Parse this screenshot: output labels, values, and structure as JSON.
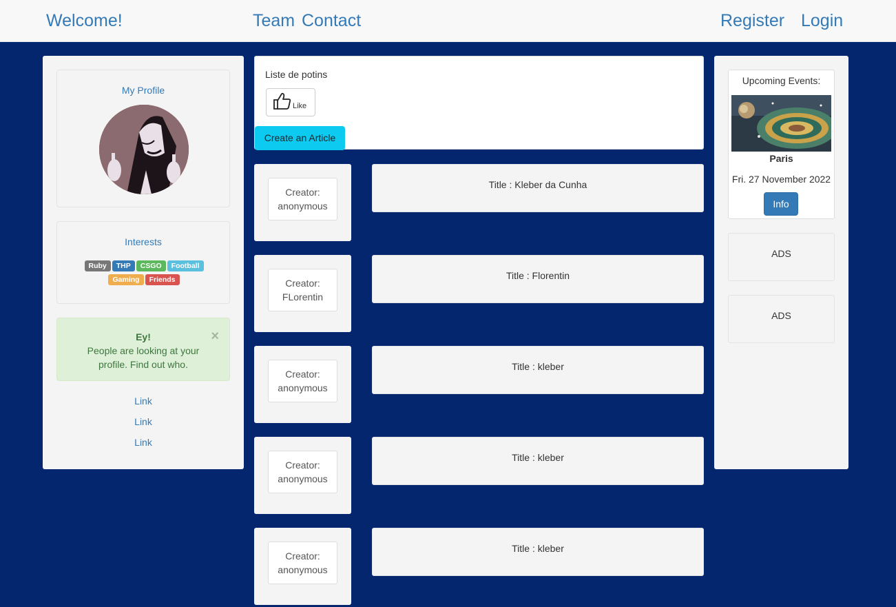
{
  "navbar": {
    "brand": "Welcome!",
    "team": "Team",
    "contact": "Contact",
    "register": "Register",
    "login": "Login"
  },
  "profile": {
    "title": "My Profile"
  },
  "interests": {
    "title": "Interests",
    "badges": [
      {
        "label": "Ruby",
        "color": "#777777"
      },
      {
        "label": "THP",
        "color": "#337ab7"
      },
      {
        "label": "CSGO",
        "color": "#5cb85c"
      },
      {
        "label": "Football",
        "color": "#5bc0de"
      },
      {
        "label": "Gaming",
        "color": "#f0ad4e"
      },
      {
        "label": "Friends",
        "color": "#d9534f"
      }
    ]
  },
  "alert": {
    "title": "Ey!",
    "line1": "People are looking at your",
    "line2": "profile. Find out who.",
    "close": "×"
  },
  "left_links": [
    "Link",
    "Link",
    "Link"
  ],
  "potins": {
    "title": "Liste de potins",
    "like_label": "Like",
    "create_label": "Create an Article"
  },
  "articles": [
    {
      "creator_label": "Creator:",
      "creator": "anonymous",
      "title": "Title : Kleber da Cunha"
    },
    {
      "creator_label": "Creator:",
      "creator": "FLorentin",
      "title": "Title : Florentin"
    },
    {
      "creator_label": "Creator:",
      "creator": "anonymous",
      "title": "Title : kleber"
    },
    {
      "creator_label": "Creator:",
      "creator": "anonymous",
      "title": "Title : kleber"
    },
    {
      "creator_label": "Creator:",
      "creator": "anonymous",
      "title": "Title : kleber"
    }
  ],
  "events": {
    "title": "Upcoming Events:",
    "city": "Paris",
    "date": "Fri. 27 November 2022",
    "info_label": "Info"
  },
  "ads": [
    "ADS",
    "ADS"
  ],
  "colors": {
    "background": "#03266e",
    "link": "#337ab7",
    "create_button": "#0dcaf0"
  }
}
